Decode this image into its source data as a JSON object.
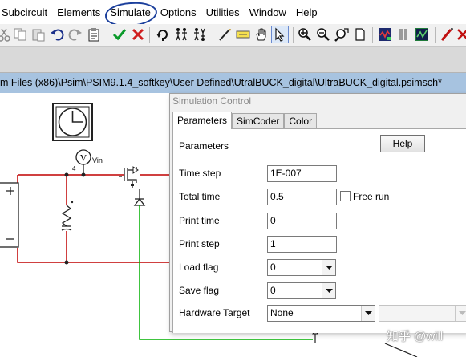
{
  "menu": {
    "items": [
      "Subcircuit",
      "Elements",
      "Simulate",
      "Options",
      "Utilities",
      "Window",
      "Help"
    ]
  },
  "path_bar": {
    "text": "m Files (x86)\\Psim\\PSIM9.1.4_softkey\\User Defined\\UtralBUCK_digital\\UltraBUCK_digital.psimsch*"
  },
  "schematic": {
    "voltmeter_symbol": "V",
    "probe_label": "Vin",
    "node_number": "4"
  },
  "dialog": {
    "title": "Simulation Control",
    "tabs": [
      "Parameters",
      "SimCoder",
      "Color"
    ],
    "section_heading": "Parameters",
    "help_label": "Help",
    "fields": {
      "time_step": {
        "label": "Time step",
        "value": "1E-007"
      },
      "total_time": {
        "label": "Total time",
        "value": "0.5"
      },
      "free_run": {
        "label": "Free run",
        "checked": false
      },
      "print_time": {
        "label": "Print time",
        "value": "0"
      },
      "print_step": {
        "label": "Print step",
        "value": "1"
      },
      "load_flag": {
        "label": "Load flag",
        "value": "0"
      },
      "save_flag": {
        "label": "Save flag",
        "value": "0"
      },
      "hardware_target": {
        "label": "Hardware Target",
        "value": "None",
        "secondary_value": ""
      }
    }
  },
  "watermark": "知乎 @will",
  "colors": {
    "annotation_circle": "#1b3f9c",
    "path_bar": "#a7c3e0",
    "wire_red": "#c00000",
    "wire_green": "#00b000"
  },
  "icons": [
    "cut-icon",
    "copy-icon",
    "paste-icon",
    "undo-icon",
    "redo-icon",
    "clipboard-icon",
    "run-check-icon",
    "cancel-icon",
    "rotate-icon",
    "flip-icon",
    "flip-vertical-icon",
    "wire-icon",
    "label-icon",
    "pan-icon",
    "select-icon",
    "zoom-in-icon",
    "zoom-out-icon",
    "zoom-fit-icon",
    "page-icon",
    "run-simulation-icon",
    "pause-icon",
    "simview-icon",
    "probe-icon",
    "close-icon"
  ]
}
